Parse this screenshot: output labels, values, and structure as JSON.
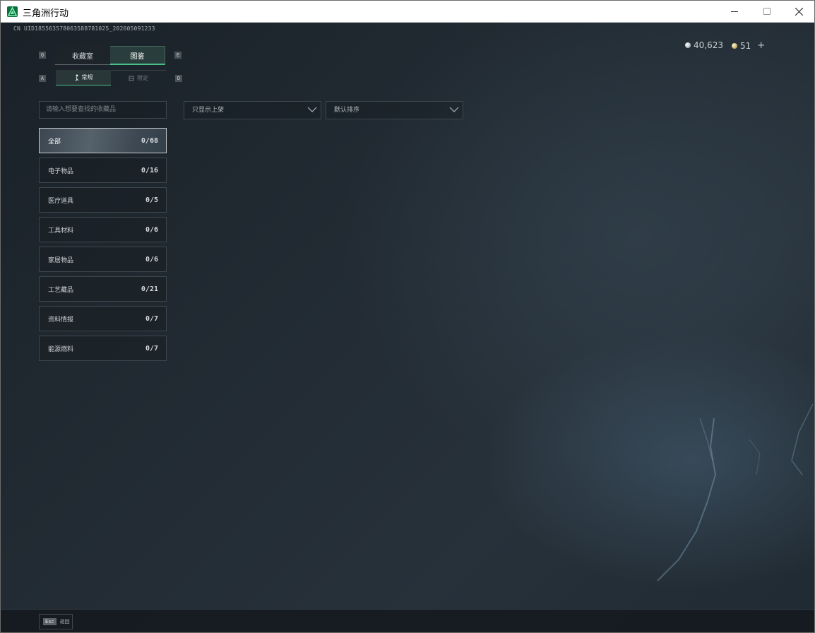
{
  "window": {
    "title": "三角洲行动",
    "minimize_icon": "minimize-icon",
    "maximize_icon": "maximize-icon",
    "close_icon": "close-icon"
  },
  "uid": "CN UID18556357806358878​1025_202605091233",
  "currency": {
    "silver": "40,623",
    "gold": "51",
    "add": "+"
  },
  "key_hints": {
    "tab_prev": "Q",
    "tab_next": "E",
    "sub_prev": "A",
    "sub_next": "D"
  },
  "tabs": [
    {
      "label": "收藏室",
      "active": false
    },
    {
      "label": "图鉴",
      "active": true
    }
  ],
  "subtabs": [
    {
      "label": "常规",
      "icon": "person-icon",
      "active": true
    },
    {
      "label": "限定",
      "icon": "limited-icon",
      "active": false
    }
  ],
  "search": {
    "placeholder": "请输入想要查找的收藏品"
  },
  "filters": {
    "shelf_filter": "只显示上架",
    "sort": "默认排序"
  },
  "categories": [
    {
      "label": "全部",
      "count": "0/68",
      "active": true
    },
    {
      "label": "电子物品",
      "count": "0/16"
    },
    {
      "label": "医疗道具",
      "count": "0/5"
    },
    {
      "label": "工具材料",
      "count": "0/6"
    },
    {
      "label": "家居物品",
      "count": "0/6"
    },
    {
      "label": "工艺藏品",
      "count": "0/21"
    },
    {
      "label": "资料情报",
      "count": "0/7"
    },
    {
      "label": "能源燃料",
      "count": "0/7"
    }
  ],
  "footer": {
    "esc_key": "Esc",
    "esc_label": "返回"
  },
  "colors": {
    "accent": "#49c08a",
    "background": "#1b2229"
  }
}
